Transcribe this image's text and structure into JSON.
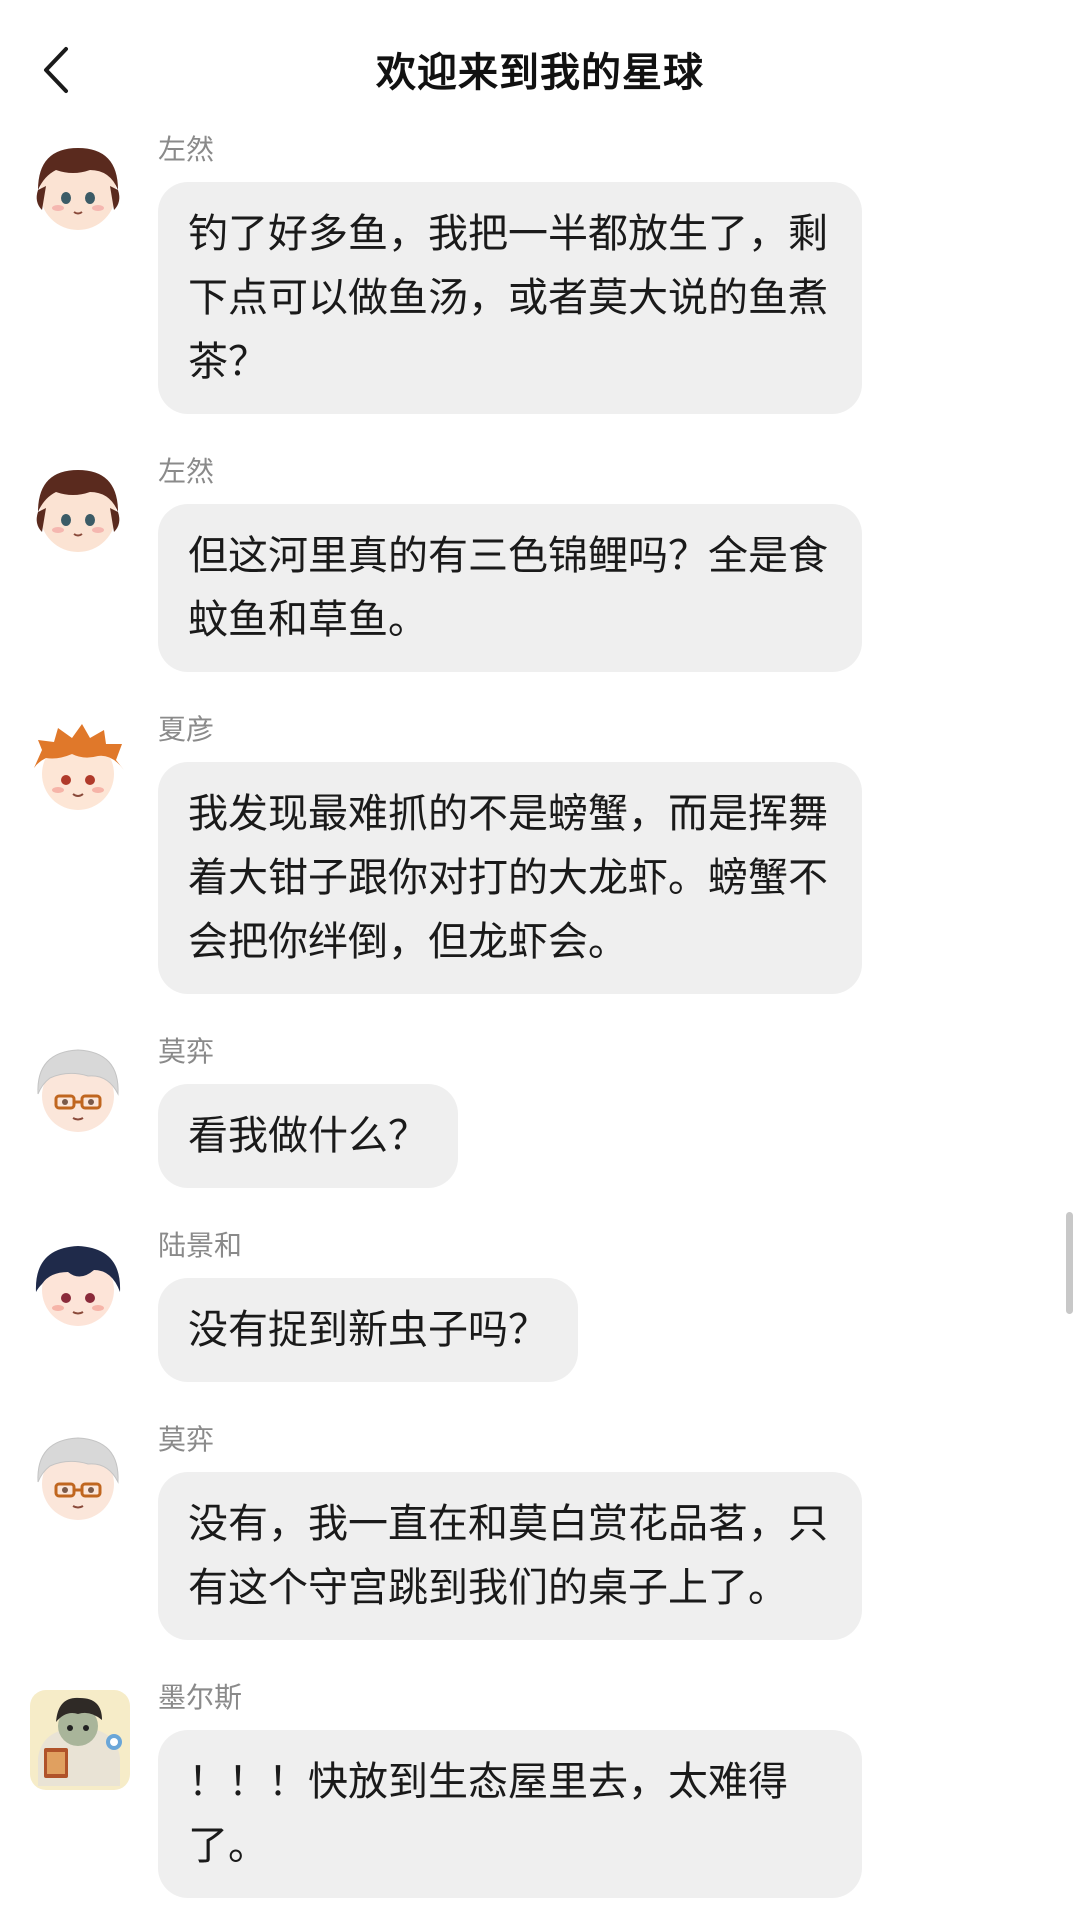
{
  "header": {
    "title": "欢迎来到我的星球",
    "back_icon": "chevron-left-icon"
  },
  "messages": [
    {
      "sender": "左然",
      "text": "钓了好多鱼，我把一半都放生了，剩下点可以做鱼汤，或者莫大说的鱼煮茶？",
      "avatar": "brown-hair-avatar"
    },
    {
      "sender": "左然",
      "text": "但这河里真的有三色锦鲤吗？全是食蚊鱼和草鱼。",
      "avatar": "brown-hair-avatar"
    },
    {
      "sender": "夏彦",
      "text": "我发现最难抓的不是螃蟹，而是挥舞着大钳子跟你对打的大龙虾。螃蟹不会把你绊倒，但龙虾会。",
      "avatar": "orange-hair-avatar"
    },
    {
      "sender": "莫弈",
      "text": "看我做什么？",
      "avatar": "silver-hair-glasses-avatar"
    },
    {
      "sender": "陆景和",
      "text": "没有捉到新虫子吗？",
      "avatar": "navy-hair-avatar"
    },
    {
      "sender": "莫弈",
      "text": "没有，我一直在和莫白赏花品茗，只有这个守宫跳到我们的桌子上了。",
      "avatar": "silver-hair-glasses-avatar"
    },
    {
      "sender": "墨尔斯",
      "text": "！！！快放到生态屋里去，太难得了。",
      "avatar": "character-with-book-avatar"
    }
  ],
  "colors": {
    "bubble": "#efefef",
    "sender_name": "#8a8a8a",
    "title": "#111111"
  }
}
